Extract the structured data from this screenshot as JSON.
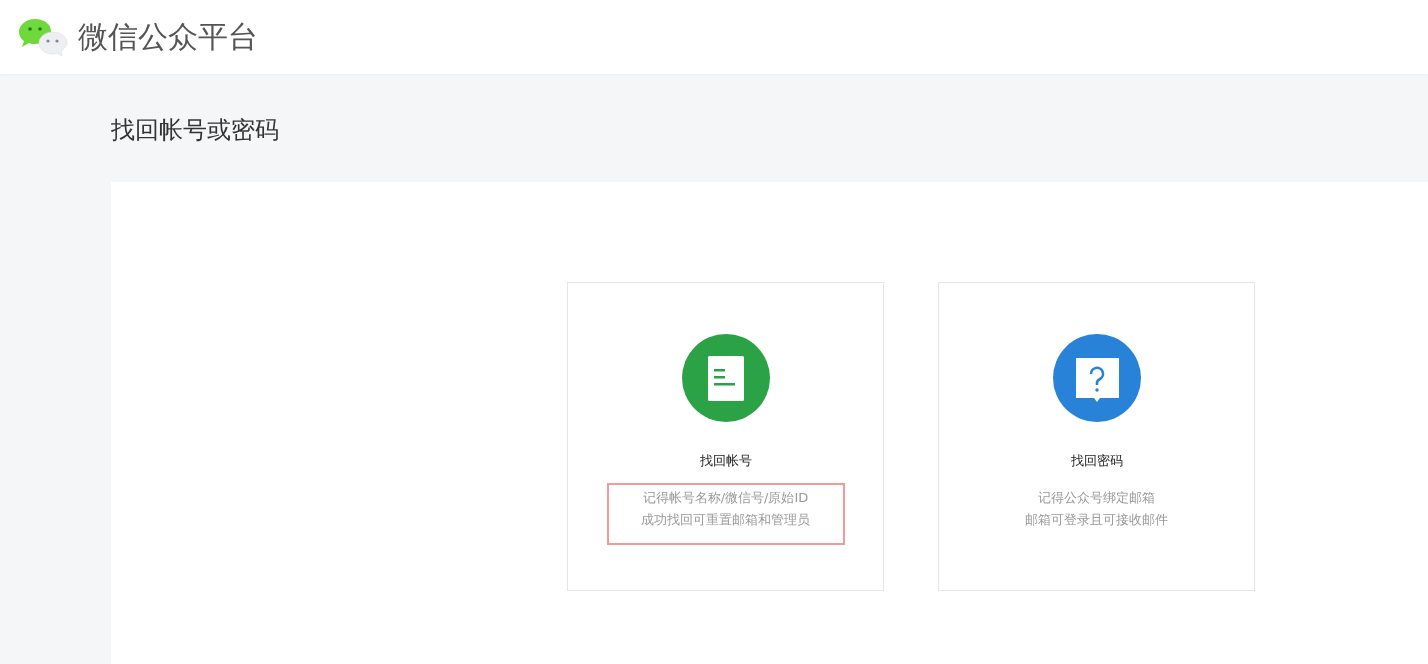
{
  "header": {
    "logo_text": "微信公众平台"
  },
  "page_title": "找回帐号或密码",
  "options": [
    {
      "kind": "account",
      "title": "找回帐号",
      "lines": [
        "记得帐号名称/微信号/原始ID",
        "成功找回可重置邮箱和管理员"
      ],
      "highlighted": true
    },
    {
      "kind": "password",
      "title": "找回密码",
      "lines": [
        "记得公众号绑定邮箱",
        "邮箱可登录且可接收邮件"
      ],
      "highlighted": false
    }
  ]
}
